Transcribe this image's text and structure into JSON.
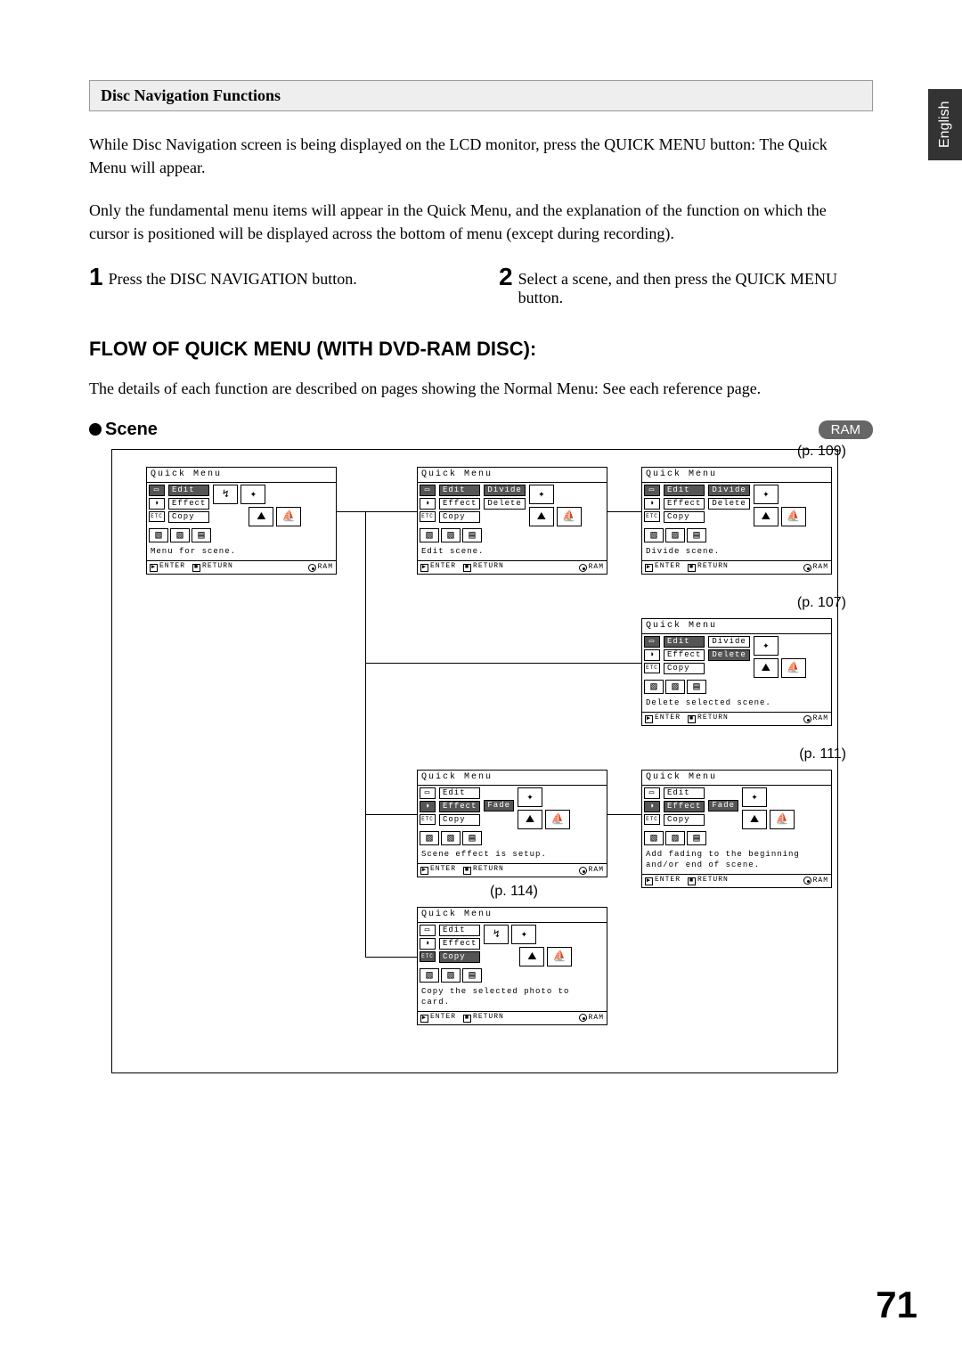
{
  "side_tab": "English",
  "header": "Disc Navigation Functions",
  "para1": "While Disc Navigation screen is being displayed on the LCD monitor, press the QUICK MENU button: The Quick Menu will appear.",
  "para2": "Only the fundamental menu items will appear in the Quick Menu, and the explanation of the function on which the cursor is positioned will be displayed across the bottom of menu (except during recording).",
  "steps": [
    {
      "num": "1",
      "text": "Press the DISC NAVIGATION button."
    },
    {
      "num": "2",
      "text": "Select a scene, and then press the QUICK MENU button."
    }
  ],
  "ram_badge": "RAM",
  "h2": "FLOW OF QUICK MENU (WITH DVD-RAM DISC):",
  "h2_after": "The details of each function are described on pages showing the Normal Menu: See each reference page.",
  "scene_label": "Scene",
  "page_refs": {
    "p109": "(p. 109)",
    "p107": "(p. 107)",
    "p111": "(p. 111)",
    "p114": "(p. 114)"
  },
  "menu": {
    "title": "Quick Menu",
    "items": [
      "Edit",
      "Effect",
      "Copy"
    ],
    "sub_divide": "Divide",
    "sub_delete": "Delete",
    "sub_fade": "Fade",
    "etc": "ETC",
    "foot_enter": "ENTER",
    "foot_return": "RETURN",
    "foot_ram": "RAM"
  },
  "desc": {
    "m1": "Menu for scene.",
    "m2": "Edit scene.",
    "m3": "Divide scene.",
    "m4": "Delete selected scene.",
    "m5": "Scene effect is setup.",
    "m6": "Add fading to the beginning and/or end of scene.",
    "m7": "Copy the selected photo to card."
  },
  "page_number": "71"
}
